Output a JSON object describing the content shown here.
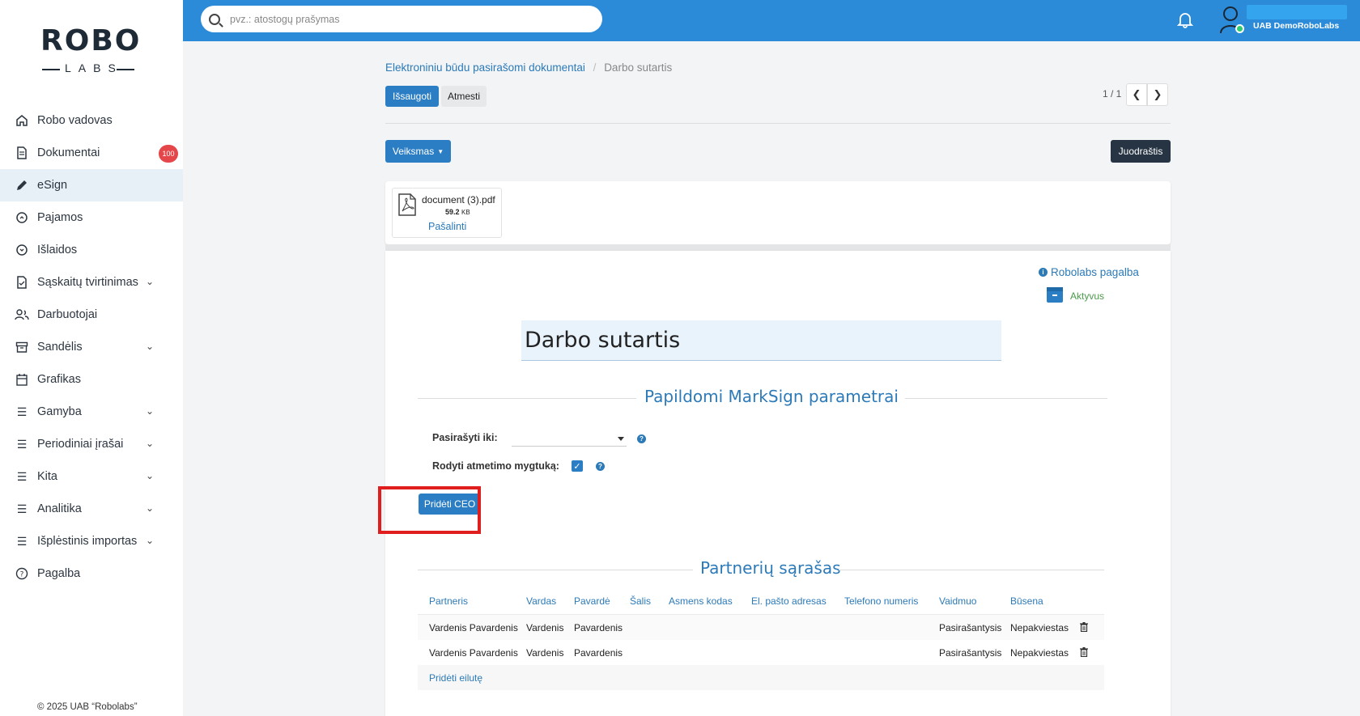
{
  "sidebar": {
    "logo_top": "ROBO",
    "logo_bottom": "LABS",
    "items": [
      {
        "label": "Robo vadovas",
        "icon": "home-icon",
        "chevron": false
      },
      {
        "label": "Dokumentai",
        "icon": "document-icon",
        "chevron": false,
        "badge": "100"
      },
      {
        "label": "eSign",
        "icon": "pen-icon",
        "chevron": false,
        "active": true
      },
      {
        "label": "Pajamos",
        "icon": "income-icon",
        "chevron": false
      },
      {
        "label": "Išlaidos",
        "icon": "expense-icon",
        "chevron": false
      },
      {
        "label": "Sąskaitų tvirtinimas",
        "icon": "invoice-check-icon",
        "chevron": true
      },
      {
        "label": "Darbuotojai",
        "icon": "users-icon",
        "chevron": false
      },
      {
        "label": "Sandėlis",
        "icon": "warehouse-icon",
        "chevron": true
      },
      {
        "label": "Grafikas",
        "icon": "calendar-icon",
        "chevron": false
      },
      {
        "label": "Gamyba",
        "icon": "list-icon",
        "chevron": true
      },
      {
        "label": "Periodiniai įrašai",
        "icon": "list-icon",
        "chevron": true
      },
      {
        "label": "Kita",
        "icon": "list-icon",
        "chevron": true
      },
      {
        "label": "Analitika",
        "icon": "list-icon",
        "chevron": true
      },
      {
        "label": "Išplėstinis importas",
        "icon": "list-icon",
        "chevron": true
      },
      {
        "label": "Pagalba",
        "icon": "help-icon",
        "chevron": false
      }
    ],
    "copyright": "© 2025 UAB “Robolabs”"
  },
  "topbar": {
    "search_placeholder": "pvz.: atostogų prašymas",
    "company": "UAB DemoRoboLabs",
    "accent": "#2b8bd8"
  },
  "breadcrumb": {
    "parent": "Elektroniniu būdu pasirašomi dokumentai",
    "current": "Darbo sutartis"
  },
  "toolbar": {
    "save_label": "Išsaugoti",
    "discard_label": "Atmesti",
    "pager": "1 / 1",
    "action_label": "Veiksmas",
    "draft_label": "Juodraštis"
  },
  "attachment": {
    "name": "document (3).pdf",
    "size_value": "59.2",
    "size_unit": "KB",
    "remove_label": "Pašalinti"
  },
  "form": {
    "help_label": "Robolabs pagalba",
    "status_label": "Aktyvus",
    "title": "Darbo sutartis",
    "section_params": "Papildomi MarkSign parametrai",
    "sign_until_label": "Pasirašyti iki:",
    "sign_until_value": "",
    "show_reject_label": "Rodyti atmetimo mygtuką:",
    "show_reject_checked": true,
    "add_ceo_label": "Pridėti CEO",
    "section_partners": "Partnerių sąrašas",
    "add_row_label": "Pridėti eilutę"
  },
  "table": {
    "headers": [
      "Partneris",
      "Vardas",
      "Pavardė",
      "Šalis",
      "Asmens kodas",
      "El. pašto adresas",
      "Telefono numeris",
      "Vaidmuo",
      "Būsena"
    ],
    "rows": [
      [
        "Vardenis Pavardenis",
        "Vardenis",
        "Pavardenis",
        "",
        "",
        "",
        "",
        "Pasirašantysis",
        "Nepakviestas"
      ],
      [
        "Vardenis Pavardenis",
        "Vardenis",
        "Pavardenis",
        "",
        "",
        "",
        "",
        "Pasirašantysis",
        "Nepakviestas"
      ]
    ]
  }
}
